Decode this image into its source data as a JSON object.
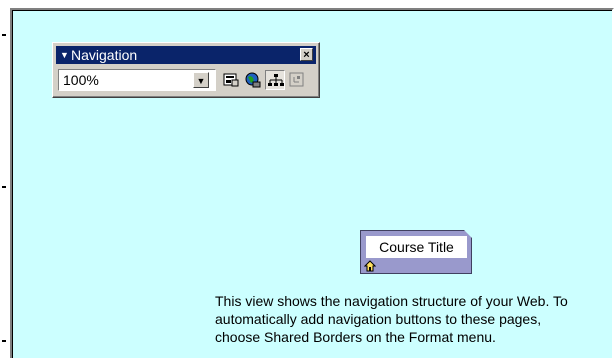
{
  "toolbar": {
    "title": "Navigation",
    "zoom_value": "100%",
    "buttons": [
      {
        "name": "external-content-icon"
      },
      {
        "name": "globe-icon"
      },
      {
        "name": "tree-structure-icon"
      },
      {
        "name": "subtree-only-icon"
      }
    ]
  },
  "node": {
    "title": "Course Title"
  },
  "info": {
    "line1": "This view shows the navigation structure of your Web. To",
    "line2": "automatically add navigation buttons to these pages,",
    "line3": "choose Shared Borders on the Format menu."
  },
  "colors": {
    "canvas_bg": "#ccffff",
    "title_bar": "#0a246a",
    "node_bg": "#9999cc"
  }
}
